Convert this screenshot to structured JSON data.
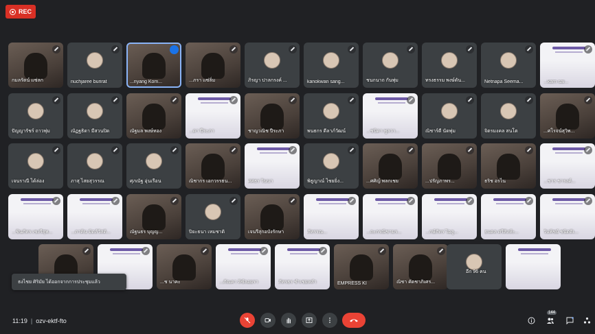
{
  "recording": {
    "label": "REC"
  },
  "participants": [
    {
      "name": "กมลรัตน์ แซ่ลก",
      "type": "cam",
      "muted": true
    },
    {
      "name": "nuchjaree burirat",
      "type": "avatar",
      "muted": true
    },
    {
      "name": "...riyang Kom...",
      "type": "cam",
      "speaking": true
    },
    {
      "name": "...ภรา แซ่ลิ่ม",
      "type": "cam",
      "muted": true
    },
    {
      "name": "ภิรญา ปาลกรงค์ ...",
      "type": "avatar",
      "muted": true
    },
    {
      "name": "kanokwan sang...",
      "type": "avatar",
      "muted": true
    },
    {
      "name": "ชนกนาถ กันพุ่ม",
      "type": "avatar",
      "muted": true
    },
    {
      "name": "ทรงธรรม พงษ์ดัน...",
      "type": "avatar",
      "muted": true
    },
    {
      "name": "Netnapa Seema...",
      "type": "avatar",
      "muted": true
    },
    {
      "name": "...karn sai...",
      "type": "slide",
      "muted": true
    },
    {
      "name": "ปัญญารัชร์ ถาวพุ่ม",
      "type": "avatar",
      "muted": true
    },
    {
      "name": "ณัฏฐธิดา มีสวนปิด",
      "type": "avatar",
      "muted": true
    },
    {
      "name": "ณัฐมล พงษ์ทอง",
      "type": "cam",
      "muted": true
    },
    {
      "name": "...ดา ปีระภา",
      "type": "slide",
      "muted": true
    },
    {
      "name": "ชาญวณิช ปีระภา",
      "type": "cam",
      "muted": true
    },
    {
      "name": "พนธกร ดีลาภ์วัฒน์",
      "type": "avatar",
      "muted": true
    },
    {
      "name": "...ชนิดา พูลวา...",
      "type": "slide",
      "muted": true
    },
    {
      "name": "ณิชาร์ดี นัดพุ่ม",
      "type": "avatar",
      "muted": true
    },
    {
      "name": "จิตรมงคล สนโต",
      "type": "avatar",
      "muted": true
    },
    {
      "name": "...ศโรจน์สุวิพ...",
      "type": "cam",
      "muted": true
    },
    {
      "name": "เจนราณี ได้ล่อง",
      "type": "avatar",
      "muted": true
    },
    {
      "name": "ภาสุ ไสยสุวรรณ",
      "type": "avatar",
      "muted": true
    },
    {
      "name": "ศุภณัฐ อุ่นเรือน",
      "type": "avatar",
      "muted": true
    },
    {
      "name": "ณิชากร เอกวรรธน...",
      "type": "cam",
      "muted": true
    },
    {
      "name": "ศศธร วินนา",
      "type": "slide",
      "muted": true
    },
    {
      "name": "พิธูญาณ์ ไชยยิ่ง...",
      "type": "avatar",
      "muted": true
    },
    {
      "name": "...ศศิญ์ พลกเชย",
      "type": "cam",
      "muted": true
    },
    {
      "name": "...ปรัญภาพร...",
      "type": "cam",
      "muted": true
    },
    {
      "name": "ธริช อรไน",
      "type": "cam",
      "muted": true
    },
    {
      "name": "...ชาร ชารงค์...",
      "type": "slide",
      "muted": true
    },
    {
      "name": "...ชินภัทร เชงรีสุพ...",
      "type": "slide",
      "muted": true
    },
    {
      "name": "...ภาคิน มิตส์วัสดิ...",
      "type": "slide",
      "muted": true
    },
    {
      "name": "ณัฐนธร บุญญ...",
      "type": "cam",
      "muted": true
    },
    {
      "name": "ปิยะธนา เหมชาติ",
      "type": "avatar",
      "muted": true
    },
    {
      "name": "เจนรีสุกอบังรักษา",
      "type": "cam",
      "muted": true
    },
    {
      "name": "ภัทรรณ...",
      "type": "slide",
      "muted": true
    },
    {
      "name": "...ถะกรณิชามร...",
      "type": "slide",
      "muted": true
    },
    {
      "name": "...กษ์ภัทร ไอลู...",
      "type": "slide",
      "muted": true
    },
    {
      "name": "ธนดล ศรีสิงห์ะ...",
      "type": "slide",
      "muted": true
    },
    {
      "name": "วันพิชย์ ชนิตติเ...",
      "type": "slide",
      "muted": true
    },
    {
      "name": "",
      "type": "cam",
      "muted": true
    },
    {
      "name": "...ง ไพบ...",
      "type": "slide",
      "muted": true
    },
    {
      "name": "...ช นาคะ",
      "type": "cam",
      "muted": true
    },
    {
      "name": "...ภัณคา ลิซ์ลอยรา",
      "type": "slide",
      "muted": true
    },
    {
      "name": "ภัทรธร ชำเชยหลำ",
      "type": "slide",
      "muted": true
    },
    {
      "name": "EMPRESS KI",
      "type": "cam",
      "muted": true
    },
    {
      "name": "ณิชา คัดชาภิเศร...",
      "type": "cam",
      "muted": true
    },
    {
      "name": "อีก 96 คน",
      "type": "more",
      "muted": false
    },
    {
      "name": "",
      "type": "slide",
      "muted": false
    }
  ],
  "toast": {
    "text": "ธงไชย ศิริมัย ได้ออกจากการประชุมแล้ว"
  },
  "meeting": {
    "time": "11:19",
    "separator": "|",
    "code": "ozv-ektf-fto"
  },
  "controls": {
    "mic": "mic-off-icon",
    "camera": "camera-icon",
    "hand": "raise-hand-icon",
    "present": "present-icon",
    "more": "more-icon",
    "end": "end-call-icon"
  },
  "side": {
    "people_count": "144"
  },
  "colors": {
    "background": "#202124",
    "tile": "#3c4043",
    "end_call": "#ea4335",
    "rec": "#d93025",
    "speaking": "#8ab4f8"
  }
}
